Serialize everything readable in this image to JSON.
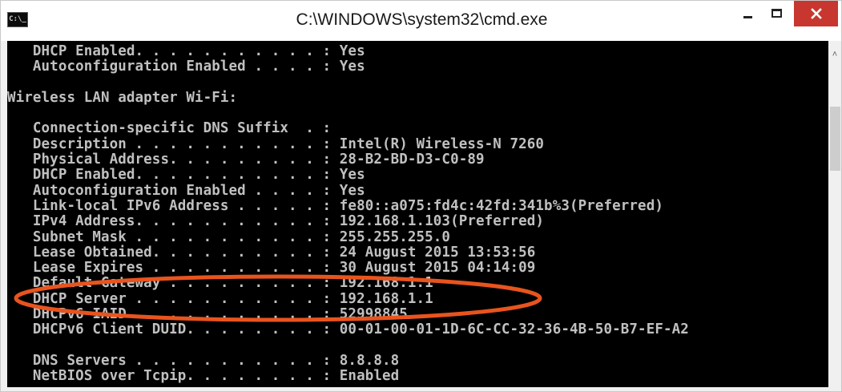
{
  "window": {
    "title": "C:\\WINDOWS\\system32\\cmd.exe",
    "icon_label": "C:\\_",
    "minimize": "minimize-icon",
    "maximize": "maximize-icon",
    "close": "close-icon",
    "close_color": "#c7372f"
  },
  "console": {
    "background": "#000000",
    "text_color": "#c0c0c0",
    "lines": [
      "   DHCP Enabled. . . . . . . . . . . : Yes",
      "   Autoconfiguration Enabled . . . . : Yes",
      "",
      "Wireless LAN adapter Wi-Fi:",
      "",
      "   Connection-specific DNS Suffix  . :",
      "   Description . . . . . . . . . . . : Intel(R) Wireless-N 7260",
      "   Physical Address. . . . . . . . . : 28-B2-BD-D3-C0-89",
      "   DHCP Enabled. . . . . . . . . . . : Yes",
      "   Autoconfiguration Enabled . . . . : Yes",
      "   Link-local IPv6 Address . . . . . : fe80::a075:fd4c:42fd:341b%3(Preferred)",
      "   IPv4 Address. . . . . . . . . . . : 192.168.1.103(Preferred)",
      "   Subnet Mask . . . . . . . . . . . : 255.255.255.0",
      "   Lease Obtained. . . . . . . . . . : 24 August 2015 13:53:56",
      "   Lease Expires . . . . . . . . . . : 30 August 2015 04:14:09",
      "   Default Gateway . . . . . . . . . : 192.168.1.1",
      "   DHCP Server . . . . . . . . . . . : 192.168.1.1",
      "   DHCPv6 IAID . . . . . . . . . . . : 52998845",
      "   DHCPv6 Client DUID. . . . . . . . : 00-01-00-01-1D-6C-CC-32-36-4B-50-B7-EF-A2",
      "",
      "   DNS Servers . . . . . . . . . . . : 8.8.8.8",
      "   NetBIOS over Tcpip. . . . . . . . : Enabled"
    ]
  },
  "annotation": {
    "shape": "ellipse",
    "color": "#e8541e",
    "highlighted_line": "DHCP Server"
  },
  "scrollbar": {
    "up_arrow": "chevron-up-icon"
  }
}
